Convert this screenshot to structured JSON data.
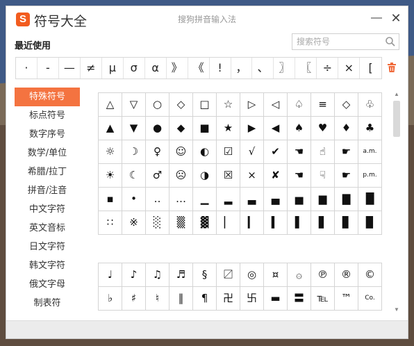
{
  "window": {
    "app_title": "符号大全",
    "ime_title": "搜狗拼音输入法",
    "logo_letter": "S",
    "min_label": "—",
    "close_label": "✕"
  },
  "recent": {
    "label": "最近使用",
    "symbols": [
      "·",
      "-",
      "—",
      "≠",
      "μ",
      "σ",
      "α",
      "》",
      "《",
      "!",
      "，",
      "、",
      "〗",
      "〖",
      "÷",
      "×",
      "["
    ]
  },
  "search": {
    "placeholder": "搜索符号"
  },
  "sidebar": {
    "categories": [
      "特殊符号",
      "标点符号",
      "数字序号",
      "数学/单位",
      "希腊/拉丁",
      "拼音/注音",
      "中文字符",
      "英文音标",
      "日文字符",
      "韩文字符",
      "俄文字母",
      "制表符"
    ],
    "active_index": 0
  },
  "grid1": [
    [
      "△",
      "▽",
      "○",
      "◇",
      "□",
      "☆",
      "▷",
      "◁",
      "♤",
      "≡",
      "◇",
      "♧"
    ],
    [
      "▲",
      "▼",
      "●",
      "◆",
      "■",
      "★",
      "▶",
      "◀",
      "♠",
      "♥",
      "♦",
      "♣"
    ],
    [
      "☼",
      "☽",
      "♀",
      "☺",
      "◐",
      "☑",
      "√",
      "✔",
      "☚",
      "☝",
      "☛",
      "a.m."
    ],
    [
      "☀",
      "☾",
      "♂",
      "☹",
      "◑",
      "☒",
      "×",
      "✘",
      "☚",
      "☟",
      "☛",
      "p.m."
    ],
    [
      "▪",
      "•",
      "‥",
      "…",
      "▁",
      "▂",
      "▃",
      "▄",
      "▅",
      "▆",
      "▇",
      "█"
    ],
    [
      "∷",
      "※",
      "░",
      "▒",
      "▓",
      "▏",
      "▎",
      "▍",
      "▌",
      "▋",
      "▊",
      "▉"
    ]
  ],
  "grid2": [
    [
      "♩",
      "♪",
      "♫",
      "♬",
      "§",
      "〼",
      "◎",
      "¤",
      "۞",
      "℗",
      "®",
      "©"
    ],
    [
      "♭",
      "♯",
      "♮",
      "‖",
      "¶",
      "卍",
      "卐",
      "▬",
      "〓",
      "℡",
      "™",
      "Co."
    ]
  ],
  "colors": {
    "accent": "#f47340",
    "brand": "#f25c1f"
  }
}
